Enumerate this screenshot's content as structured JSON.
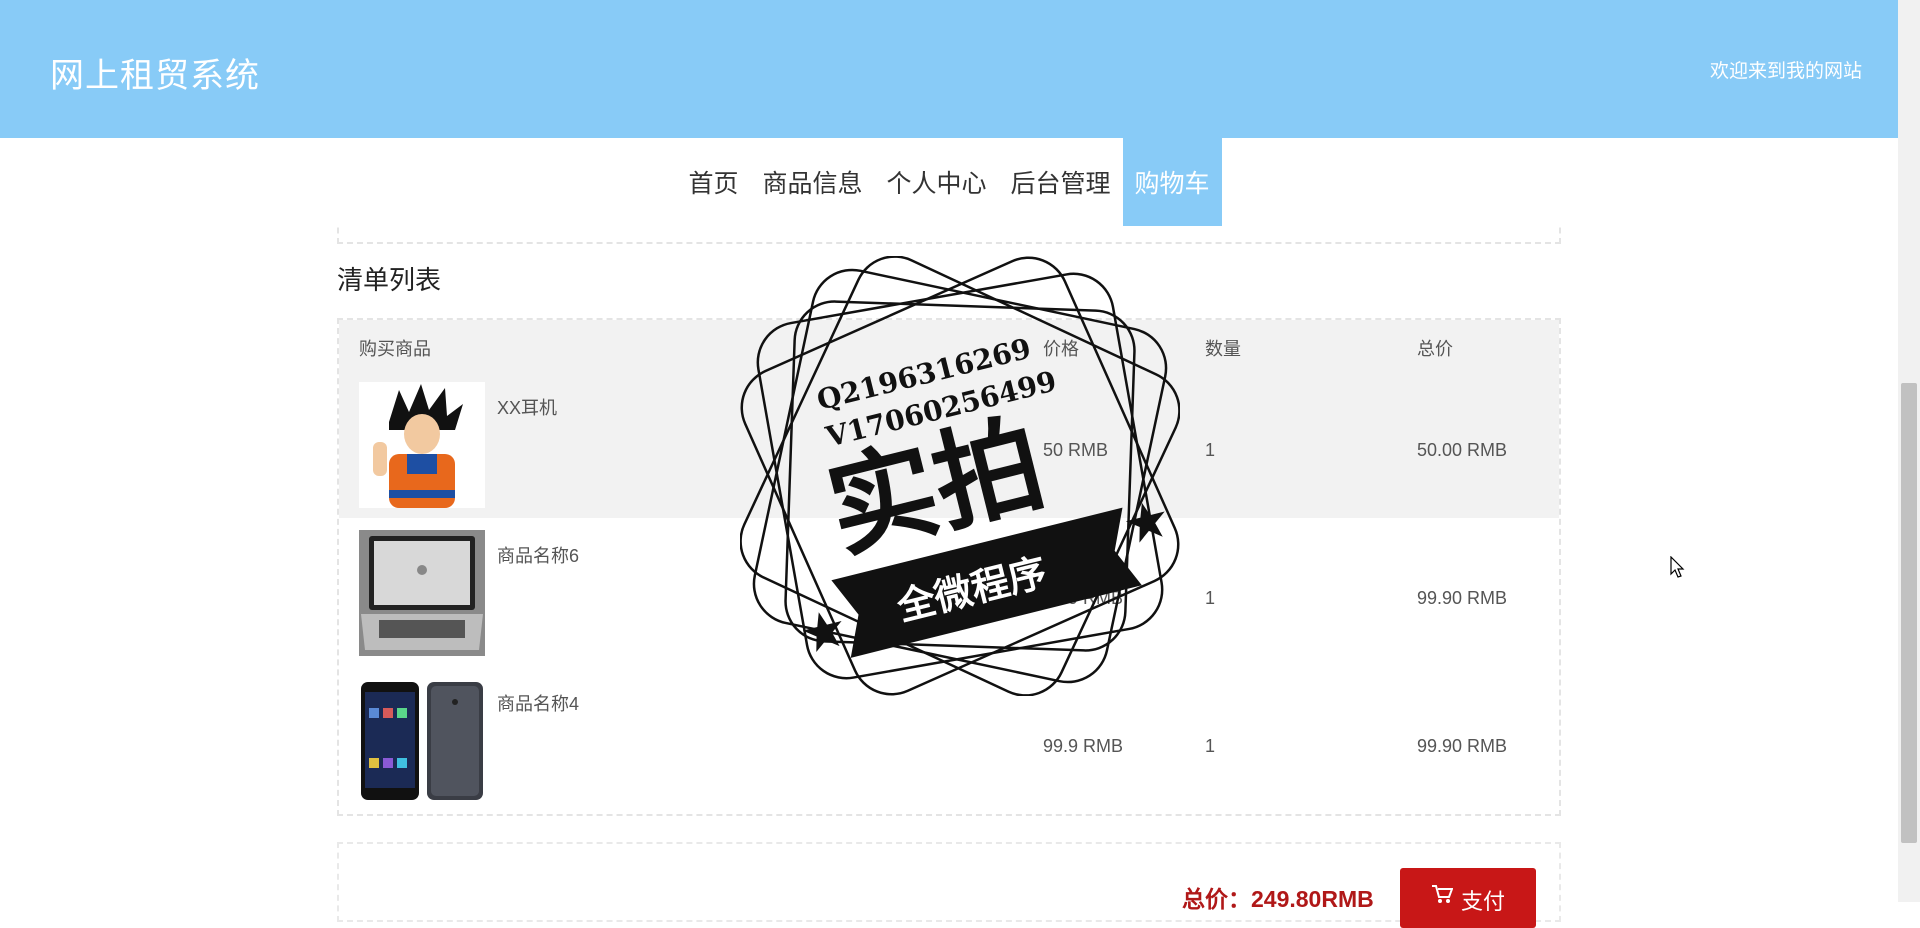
{
  "header": {
    "title": "网上租贸系统",
    "welcome": "欢迎来到我的网站"
  },
  "nav": {
    "items": [
      {
        "label": "首页"
      },
      {
        "label": "商品信息"
      },
      {
        "label": "个人中心"
      },
      {
        "label": "后台管理"
      },
      {
        "label": "购物车",
        "active": true
      }
    ]
  },
  "section": {
    "title": "清单列表"
  },
  "table": {
    "headers": [
      "购买商品",
      "价格",
      "数量",
      "总价"
    ],
    "rows": [
      {
        "name": "XX耳机",
        "price": "50 RMB",
        "qty": "1",
        "total": "50.00 RMB",
        "image": "cartoon-figure"
      },
      {
        "name": "商品名称6",
        "price": "99.9 RMB",
        "qty": "1",
        "total": "99.90 RMB",
        "image": "laptop"
      },
      {
        "name": "商品名称4",
        "price": "99.9 RMB",
        "qty": "1",
        "total": "99.90 RMB",
        "image": "phone"
      }
    ]
  },
  "summary": {
    "total": "总价：249.80RMB",
    "pay_label": "支付"
  },
  "watermark": {
    "contact1": "Q2196316269",
    "contact2": "V17060256499",
    "main": "实拍",
    "banner": "全微程序"
  },
  "colors": {
    "header_bg": "#88cbf7",
    "pay_button": "#c81717",
    "total_text": "#b01818"
  }
}
